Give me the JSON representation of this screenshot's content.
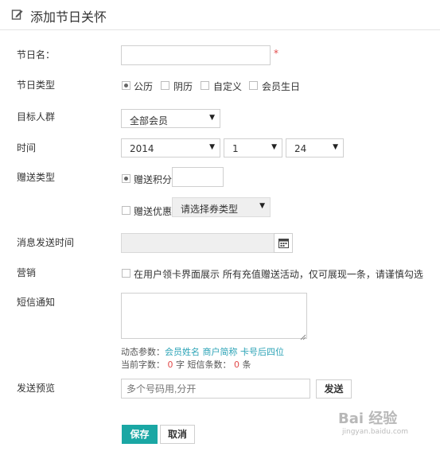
{
  "header": {
    "title": "添加节日关怀"
  },
  "labels": {
    "holiday_name": "节日名：",
    "holiday_type": "节日类型",
    "target": "目标人群",
    "time": "时间",
    "gift_type": "赠送类型",
    "send_time": "消息发送时间",
    "marketing": "营销",
    "sms": "短信通知",
    "preview": "发送预览"
  },
  "holiday_name": {
    "value": "",
    "required_mark": "*"
  },
  "holiday_types": [
    "公历",
    "阴历",
    "自定义",
    "会员生日"
  ],
  "holiday_type_selected": "公历",
  "target_select": {
    "value": "全部会员"
  },
  "time": {
    "year": "2014",
    "month": "1",
    "day": "24"
  },
  "gift": {
    "points_label": "赠送积分",
    "points_value": "",
    "coupon_label": "赠送优惠",
    "coupon_select": "请选择券类型"
  },
  "send_time": {
    "value": ""
  },
  "marketing": {
    "text": "在用户领卡界面展示 所有充值赠送活动，仅可展现一条，请谨慎勾选"
  },
  "sms": {
    "value": "",
    "params_prefix": "动态参数：",
    "params": [
      "会员姓名",
      "商户简称",
      "卡号后四位"
    ],
    "count_prefix": "当前字数：",
    "char_count": "0",
    "char_unit": "字 短信条数：",
    "msg_count": "0",
    "msg_unit": "条"
  },
  "preview": {
    "placeholder": "多个号码用,分开",
    "send_label": "发送"
  },
  "actions": {
    "save": "保存",
    "cancel": "取消"
  },
  "watermark": {
    "text": "Bai 经验",
    "sub": "jingyan.baidu.com"
  },
  "colors": {
    "accent": "#1aa7a4",
    "link": "#2ba3b6",
    "required": "#e24a4a"
  }
}
